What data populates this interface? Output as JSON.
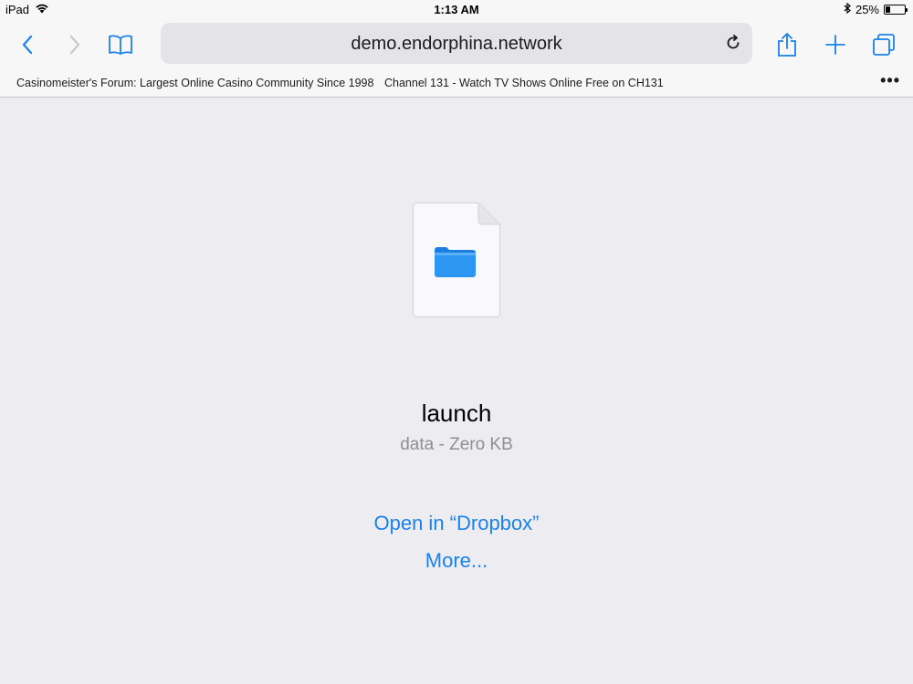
{
  "status_bar": {
    "device": "iPad",
    "time": "1:13 AM",
    "battery_percent_label": "25%",
    "battery_level": 0.25
  },
  "toolbar": {
    "url": "demo.endorphina.network"
  },
  "favorites": [
    "Casinomeister's Forum: Largest Online Casino Community Since 1998",
    "Channel 131 - Watch TV Shows Online Free on CH131"
  ],
  "file": {
    "name": "launch",
    "meta": "data - Zero KB"
  },
  "actions": {
    "open_in": "Open in “Dropbox”",
    "more": "More..."
  },
  "colors": {
    "accent": "#1a82e8",
    "folder": "#1f8ef1",
    "background": "#ececf1"
  }
}
